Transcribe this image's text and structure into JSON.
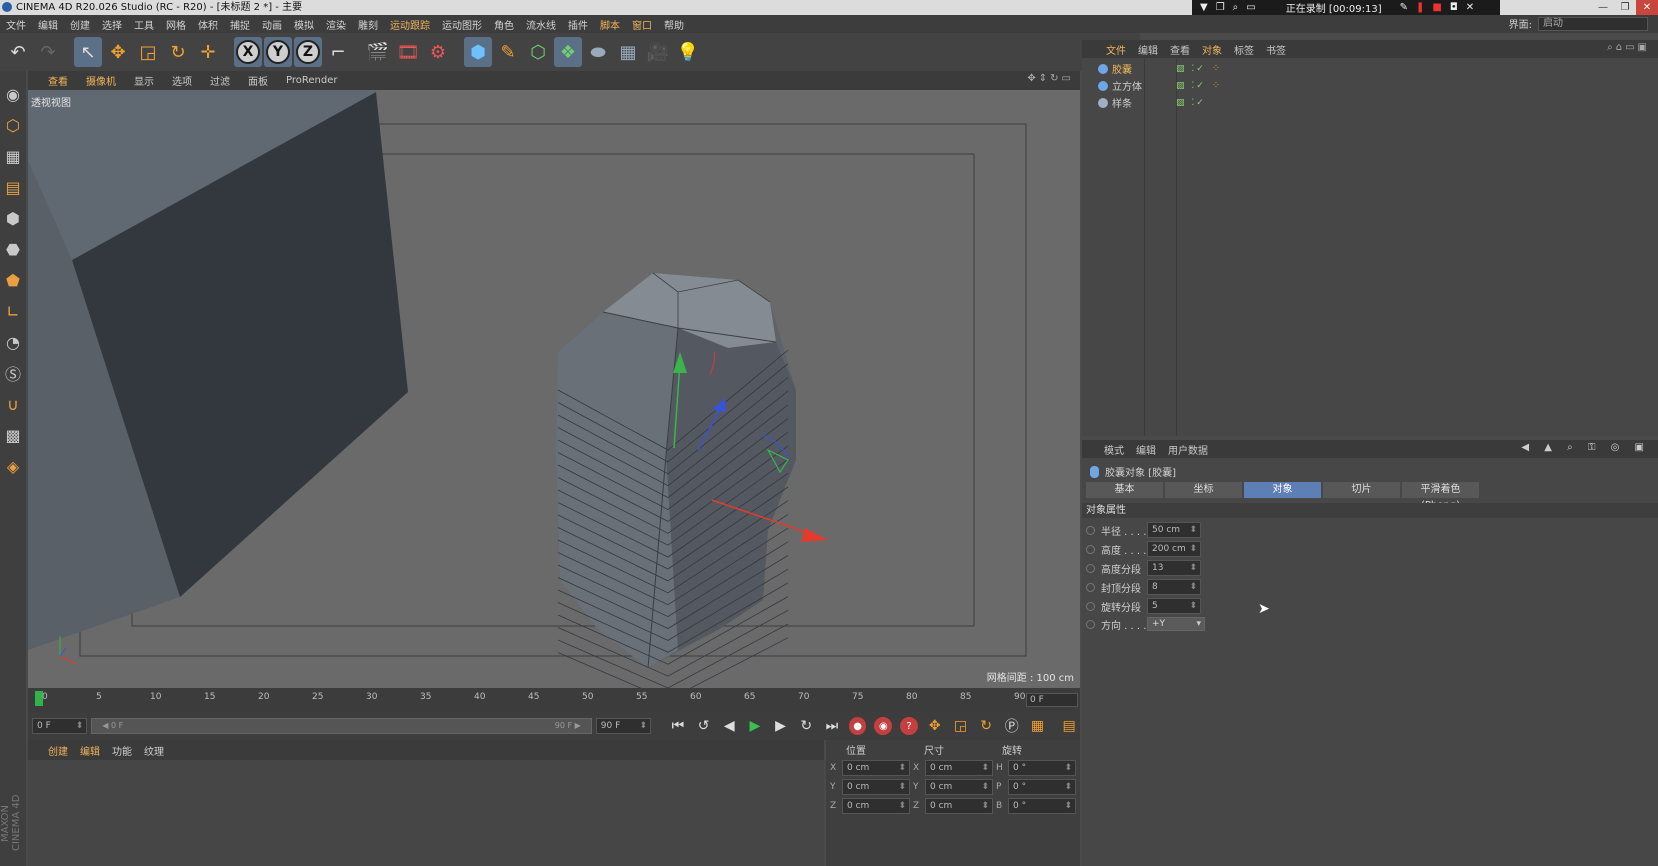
{
  "window": {
    "title": "CINEMA 4D R20.026 Studio (RC - R20) - [未标题 2 *] - 主要",
    "recording": "正在录制 [00:09:13]"
  },
  "menubar": {
    "items": [
      "文件",
      "编辑",
      "创建",
      "选择",
      "工具",
      "网格",
      "体积",
      "捕捉",
      "动画",
      "模拟",
      "渲染",
      "雕刻",
      "运动跟踪",
      "运动图形",
      "角色",
      "流水线",
      "插件",
      "脚本",
      "窗口",
      "帮助"
    ],
    "layout_label": "界面:",
    "layout_value": "启动"
  },
  "toolbar": {
    "icons": [
      "undo-icon",
      "redo-icon",
      "select-icon",
      "move-icon",
      "scale-icon",
      "rotate-icon",
      "live-move-icon",
      "x-axis-icon",
      "y-axis-icon",
      "z-axis-icon",
      "coord-system-icon",
      "render-view-icon",
      "render-picture-viewer-icon",
      "render-settings-icon",
      "cube-icon",
      "pen-icon",
      "subdivision-icon",
      "cloner-icon",
      "deformer-icon",
      "floor-icon",
      "camera-icon",
      "light-icon"
    ],
    "axes": [
      "X",
      "Y",
      "Z"
    ]
  },
  "viewport": {
    "menu": [
      "查看",
      "摄像机",
      "显示",
      "选项",
      "过滤",
      "面板",
      "ProRender"
    ],
    "title": "透视视图",
    "grid_spacing": "网格间距 : 100 cm"
  },
  "timeline": {
    "ticks": [
      "0",
      "5",
      "10",
      "15",
      "20",
      "25",
      "30",
      "35",
      "40",
      "45",
      "50",
      "55",
      "60",
      "65",
      "70",
      "75",
      "80",
      "85",
      "90"
    ],
    "current_frame": "0 F"
  },
  "playback": {
    "start": "0 F",
    "range_start": "0 F",
    "range_end": "90 F",
    "end": "90 F"
  },
  "materials": {
    "menu": [
      "创建",
      "编辑",
      "功能",
      "纹理"
    ]
  },
  "coords": {
    "headers": [
      "位置",
      "尺寸",
      "旋转"
    ],
    "rows": [
      {
        "axis": "X",
        "pos": "0 cm",
        "size_axis": "X",
        "size": "0 cm",
        "rot_axis": "H",
        "rot": "0 °"
      },
      {
        "axis": "Y",
        "pos": "0 cm",
        "size_axis": "Y",
        "size": "0 cm",
        "rot_axis": "P",
        "rot": "0 °"
      },
      {
        "axis": "Z",
        "pos": "0 cm",
        "size_axis": "Z",
        "size": "0 cm",
        "rot_axis": "B",
        "rot": "0 °"
      }
    ]
  },
  "objects": {
    "menu": [
      "文件",
      "编辑",
      "查看",
      "对象",
      "标签",
      "书签"
    ],
    "items": [
      {
        "name": "胶囊",
        "selected": true,
        "color": "#6ea6e6"
      },
      {
        "name": "立方体",
        "selected": false,
        "color": "#6ea6e6"
      },
      {
        "name": "样条",
        "selected": false,
        "color": "#9fb0c6"
      }
    ]
  },
  "attributes": {
    "menu": [
      "模式",
      "编辑",
      "用户数据"
    ],
    "object_title": "胶囊对象 [胶囊]",
    "tabs": [
      "基本",
      "坐标",
      "对象",
      "切片",
      "平滑着色(Phong)"
    ],
    "active_tab": "对象",
    "section": "对象属性",
    "params": [
      {
        "label": "半径 . . . .",
        "value": "50 cm"
      },
      {
        "label": "高度 . . . .",
        "value": "200 cm"
      },
      {
        "label": "高度分段",
        "value": "13"
      },
      {
        "label": "封顶分段",
        "value": "8"
      },
      {
        "label": "旋转分段",
        "value": "5"
      }
    ],
    "orientation_label": "方向 . . . .",
    "orientation_value": "+Y"
  },
  "brand": "MAXON CINEMA 4D"
}
